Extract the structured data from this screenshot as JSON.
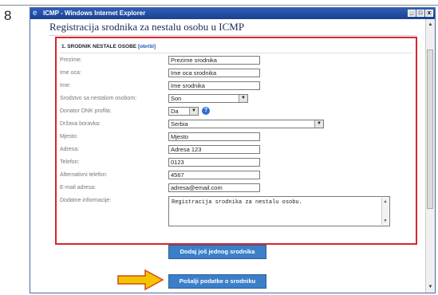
{
  "step_number": "8",
  "window": {
    "title": "ICMP - Windows Internet Explorer",
    "buttons": [
      "_",
      "□",
      "x"
    ]
  },
  "page": {
    "heading": "Registracija srodnika za nestalu osobu u ICMP"
  },
  "section": {
    "title": "1. SRODNIK NESTALE OSOBE",
    "delete_link": "[obriši]"
  },
  "fields": {
    "prezime": {
      "label": "Prezime:",
      "value": "Prezime srodnika"
    },
    "ime_oca": {
      "label": "Ime oca:",
      "value": "Ime oca srodnika"
    },
    "ime": {
      "label": "Ime:",
      "value": "Ime srodnika"
    },
    "srodstvo": {
      "label": "Srodstvo sa nestalom osobom:",
      "value": "Son"
    },
    "donator": {
      "label": "Donator DNK profila:",
      "value": "Da"
    },
    "drzava": {
      "label": "Država boravka:",
      "value": "Serbia"
    },
    "mjesto": {
      "label": "Mjesto:",
      "value": "Mjesto"
    },
    "adresa": {
      "label": "Adresa:",
      "value": "Adresa 123"
    },
    "telefon": {
      "label": "Telefon:",
      "value": "0123"
    },
    "alt_telefon": {
      "label": "Alternativni telefon:",
      "value": "4567"
    },
    "email": {
      "label": "E-mail adresa:",
      "value": "adresa@email.com"
    },
    "dodatne": {
      "label": "Dodatne informacije:",
      "value": "Registracija srodnika za nestalu osobu."
    }
  },
  "buttons": {
    "add_relative": "Dodaj još jednog srodnika",
    "submit": "Pošalji podatke o srodniku"
  },
  "icons": {
    "browser": "ie-icon",
    "help": "help-icon",
    "pointer": "arrow-right-icon"
  },
  "colors": {
    "titlebar": "#1c3f8f",
    "form_border": "#d6262e",
    "button": "#3b7fc9",
    "arrow": "#f5c400"
  }
}
